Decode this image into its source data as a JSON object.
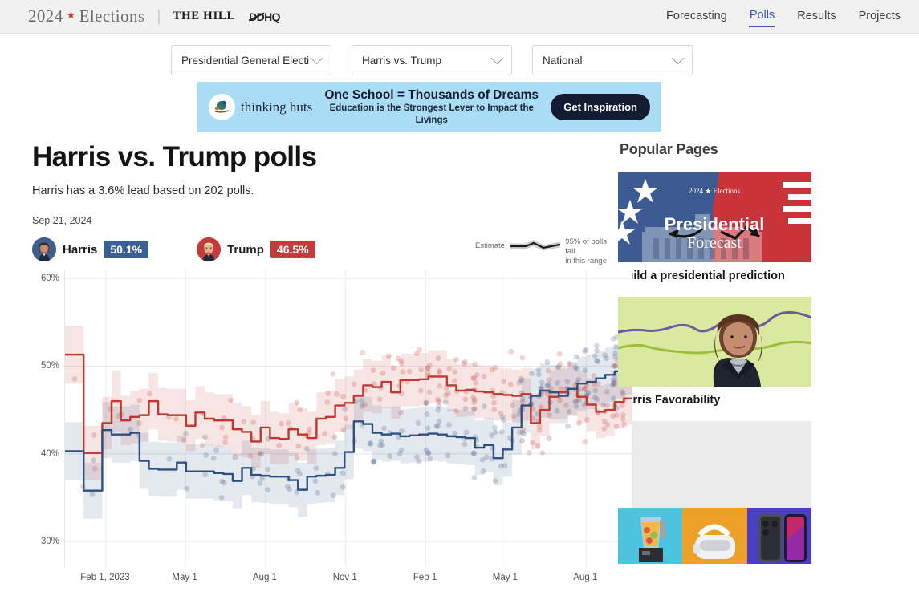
{
  "header": {
    "brand_year": "2024",
    "brand_star": "★",
    "brand_elections": "Elections",
    "brand_separator": "|",
    "brand_hill": "THE HILL",
    "brand_ddhq": "DDHQ",
    "nav": [
      {
        "label": "Forecasting",
        "active": false
      },
      {
        "label": "Polls",
        "active": true
      },
      {
        "label": "Results",
        "active": false
      },
      {
        "label": "Projects",
        "active": false
      }
    ]
  },
  "filters": [
    {
      "name": "race-type",
      "value": "Presidential General Electi"
    },
    {
      "name": "matchup",
      "value": "Harris vs. Trump"
    },
    {
      "name": "geography",
      "value": "National"
    }
  ],
  "ad": {
    "brand": "thinking huts",
    "headline": "One School = Thousands of Dreams",
    "subline": "Education is the Strongest Lever to Impact the Livings",
    "cta": "Get Inspiration"
  },
  "main": {
    "title": "Harris vs. Trump polls",
    "subtitle": "Harris has a 3.6% lead based on 202 polls.",
    "as_of_date": "Sep 21, 2024",
    "candidates": [
      {
        "name": "Harris",
        "pct": "50.1%",
        "color": "#3a5f93"
      },
      {
        "name": "Trump",
        "pct": "46.5%",
        "color": "#c33b3b"
      }
    ],
    "estimate_legend": {
      "estimate_label": "Estimate",
      "range_line1": "95% of polls fall",
      "range_line2": "in this range"
    }
  },
  "chart_data": {
    "type": "line",
    "title": "Harris vs. Trump polls",
    "xlabel": "",
    "ylabel": "",
    "ylim": [
      27,
      61
    ],
    "yticks": [
      30,
      40,
      50,
      60
    ],
    "ytick_labels": [
      "30%",
      "40%",
      "50%",
      "60%"
    ],
    "grid": true,
    "legend_position": "top-right",
    "x_tick_labels": [
      "Feb 1, 2023",
      "May 1",
      "Aug 1",
      "Nov 1",
      "Feb 1",
      "May 1",
      "Aug 1"
    ],
    "x_tick_positions": [
      0.072,
      0.212,
      0.353,
      0.494,
      0.635,
      0.776,
      0.917
    ],
    "series": [
      {
        "name": "Trump",
        "color": "#c3372f",
        "band_color": "rgba(195,55,47,0.13)",
        "values": [
          51.3,
          51.3,
          40.1,
          40.1,
          43.5,
          46.0,
          43.8,
          44.2,
          44.4,
          46.0,
          44.5,
          44.4,
          44.4,
          43.2,
          44.7,
          44.0,
          43.8,
          43.8,
          42.8,
          42.5,
          41.4,
          43.0,
          41.8,
          41.7,
          42.8,
          42.2,
          41.8,
          44.0,
          44.2,
          45.5,
          45.8,
          46.6,
          47.8,
          47.6,
          48.2,
          47.0,
          48.4,
          48.4,
          48.5,
          48.8,
          48.8,
          47.8,
          47.2,
          47.3,
          47.1,
          47.0,
          46.8,
          46.7,
          46.6,
          46.8,
          43.5,
          45.0,
          46.5,
          47.0,
          47.4,
          46.5,
          45.6,
          44.8,
          45.0,
          45.9,
          46.3,
          46.5
        ],
        "band_low": [
          48.0,
          48.0,
          37.0,
          37.0,
          40.5,
          42.5,
          41.0,
          41.2,
          41.4,
          42.8,
          41.5,
          41.4,
          41.4,
          40.3,
          41.7,
          41.0,
          40.8,
          40.8,
          39.8,
          39.6,
          38.4,
          40.0,
          38.8,
          38.8,
          39.8,
          39.2,
          38.8,
          41.0,
          41.2,
          42.5,
          42.8,
          43.6,
          44.8,
          44.6,
          45.2,
          44.0,
          45.4,
          45.4,
          45.5,
          45.8,
          45.8,
          44.8,
          44.2,
          44.3,
          44.1,
          44.0,
          43.8,
          43.7,
          43.6,
          43.8,
          40.5,
          42.0,
          43.5,
          44.0,
          44.4,
          43.5,
          42.6,
          41.8,
          42.0,
          42.9,
          43.3,
          43.5
        ],
        "band_high": [
          54.6,
          54.6,
          43.2,
          43.2,
          46.5,
          49.5,
          46.6,
          47.2,
          47.4,
          49.2,
          47.5,
          47.4,
          47.4,
          46.1,
          47.7,
          47.0,
          46.8,
          46.8,
          45.8,
          45.4,
          44.4,
          46.0,
          44.8,
          44.6,
          45.8,
          45.2,
          44.8,
          47.0,
          47.2,
          48.5,
          48.8,
          49.6,
          50.8,
          50.6,
          51.2,
          50.0,
          51.4,
          51.4,
          51.5,
          51.8,
          51.8,
          50.8,
          50.2,
          50.3,
          50.1,
          50.0,
          49.8,
          49.7,
          49.6,
          49.8,
          46.5,
          48.0,
          49.5,
          50.0,
          50.4,
          49.5,
          48.6,
          47.8,
          48.0,
          48.9,
          49.3,
          49.5
        ]
      },
      {
        "name": "Harris",
        "color": "#2e5180",
        "band_color": "rgba(46,81,128,0.13)",
        "values": [
          40.3,
          40.3,
          35.8,
          35.8,
          42.7,
          42.2,
          42.2,
          42.4,
          39.2,
          38.3,
          38.2,
          38.2,
          39.0,
          38.0,
          38.0,
          38.0,
          37.8,
          37.7,
          36.9,
          38.4,
          37.6,
          37.5,
          37.4,
          37.4,
          37.0,
          35.9,
          37.4,
          37.5,
          37.6,
          38.4,
          40.2,
          43.7,
          43.4,
          42.4,
          42.2,
          42.3,
          42.0,
          42.1,
          42.2,
          42.3,
          42.2,
          42.0,
          41.9,
          41.8,
          40.7,
          41.0,
          39.5,
          40.5,
          43.0,
          45.5,
          46.6,
          47.2,
          47.0,
          46.6,
          47.4,
          48.0,
          48.2,
          48.6,
          49.0,
          49.4,
          49.8,
          50.1
        ],
        "band_low": [
          37.0,
          37.0,
          32.6,
          32.6,
          39.5,
          39.0,
          39.0,
          39.2,
          36.0,
          35.2,
          35.1,
          35.1,
          35.9,
          34.9,
          34.9,
          34.9,
          34.7,
          34.6,
          33.8,
          35.3,
          34.5,
          34.4,
          34.3,
          34.3,
          33.9,
          32.8,
          34.3,
          34.4,
          34.5,
          35.3,
          37.1,
          40.6,
          40.3,
          39.3,
          39.1,
          39.2,
          38.9,
          39.0,
          39.1,
          39.2,
          39.1,
          38.9,
          38.8,
          38.7,
          37.6,
          37.9,
          36.4,
          37.4,
          39.9,
          42.4,
          43.5,
          44.1,
          43.9,
          43.5,
          44.3,
          44.9,
          45.1,
          45.5,
          45.9,
          46.3,
          46.7,
          47.0
        ],
        "band_high": [
          43.6,
          43.6,
          39.0,
          39.0,
          45.9,
          45.4,
          45.4,
          45.6,
          42.4,
          41.4,
          41.3,
          41.3,
          42.1,
          41.1,
          41.1,
          41.1,
          40.9,
          40.8,
          40.0,
          41.5,
          40.7,
          40.6,
          40.5,
          40.5,
          40.1,
          39.0,
          40.5,
          40.6,
          40.7,
          41.5,
          43.3,
          46.8,
          46.5,
          45.5,
          45.3,
          45.4,
          45.1,
          45.2,
          45.3,
          45.4,
          45.3,
          45.1,
          45.0,
          44.9,
          43.8,
          44.1,
          42.6,
          43.6,
          46.1,
          48.6,
          49.7,
          50.3,
          50.1,
          49.7,
          50.5,
          51.1,
          51.3,
          51.7,
          52.1,
          52.5,
          52.9,
          53.2
        ]
      }
    ],
    "scatter_note": "individual poll results shown as semi-transparent dots colored by candidate"
  },
  "sidebar": {
    "title": "Popular Pages",
    "cards": [
      {
        "caption": "Build a presidential prediction",
        "thumb_kind": "presidential-forecast",
        "thumb_text_top": "2024 ★ Elections",
        "thumb_text_main": "Presidential",
        "thumb_text_sub": "Forecast"
      },
      {
        "caption": "Harris Favorability",
        "thumb_kind": "harris-favorability"
      },
      {
        "caption": "",
        "thumb_kind": "placeholder"
      }
    ]
  }
}
